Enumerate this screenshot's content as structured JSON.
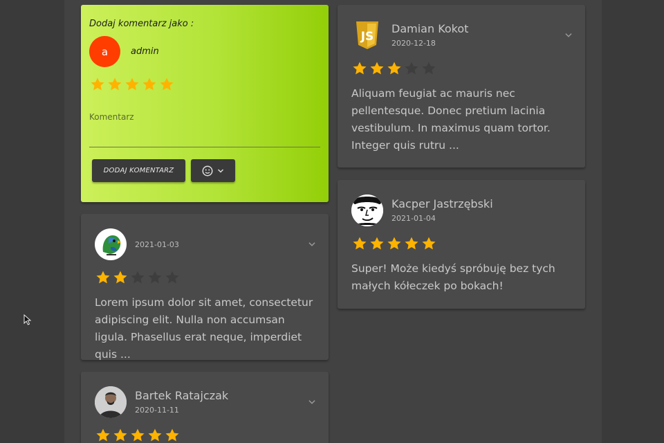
{
  "add_form": {
    "title": "Dodaj komentarz jako :",
    "user_initial": "a",
    "user_name": "admin",
    "rating": 5,
    "comment_placeholder": "Komentarz",
    "submit_label": "DODAJ KOMENTARZ",
    "emoji_icon": "smiley-icon"
  },
  "reviews": [
    {
      "author": "",
      "date": "2021-01-03",
      "rating": 2,
      "text": "Lorem ipsum dolor sit amet, consectetur adipiscing elit. Nulla non accumsan ligula. Phasellus erat neque, imperdiet quis ...",
      "avatar": "parrot-avatar"
    },
    {
      "author": "Damian Kokot",
      "date": "2020-12-18",
      "rating": 3,
      "text": "Aliquam feugiat ac mauris nec pellentesque. Donec pretium lacinia vestibulum. In maximus quam tortor. Integer quis rutru ...",
      "avatar": "js-logo-avatar"
    },
    {
      "author": "Kacper Jastrzębski",
      "date": "2021-01-04",
      "rating": 5,
      "text": "Super! Może kiedyś spróbuję bez tych małych kółeczek po bokach!",
      "avatar": "face-avatar"
    },
    {
      "author": "Bartek Ratajczak",
      "date": "2020-11-11",
      "rating": 5,
      "text": "",
      "avatar": "person-avatar"
    }
  ],
  "colors": {
    "star_filled": "#ffb300",
    "star_empty": "#3e3e3e",
    "accent_avatar": "#ff3d00"
  }
}
